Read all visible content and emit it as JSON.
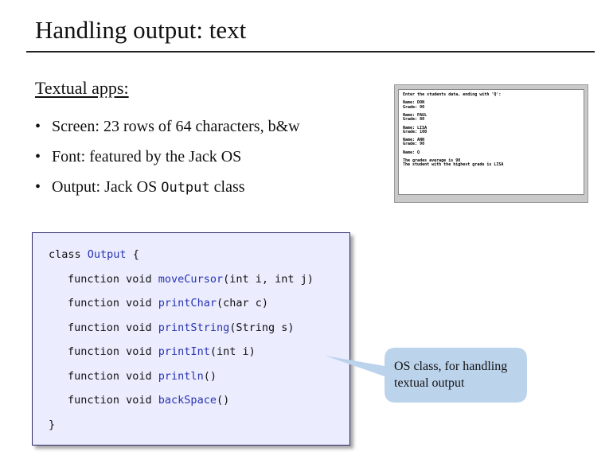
{
  "slide": {
    "title": "Handling output: text",
    "section_heading": "Textual apps:",
    "bullets": [
      {
        "text": "Screen: 23 rows of 64 characters, b&w"
      },
      {
        "text": "Font: featured by the Jack OS"
      },
      {
        "before": "Output: Jack OS ",
        "code": "Output",
        "after": " class"
      }
    ]
  },
  "screen_demo": {
    "lines": [
      "Enter the students data, ending with 'Q':",
      "",
      "Name: DON",
      "Grade: 90",
      "",
      "Name: PAUL",
      "Grade: 80",
      "",
      "Name: LISA",
      "Grade: 100",
      "",
      "Name: ANN",
      "Grade: 90",
      "",
      "Name: Q",
      "",
      "The grades average is 90",
      "The student with the highest grade is LISA"
    ]
  },
  "code": {
    "class_kw": "class ",
    "class_name": "Output",
    "open_brace": " {",
    "close_brace": "}",
    "functions": [
      {
        "prefix": "function void ",
        "name": "moveCursor",
        "params": "(int i, int j)"
      },
      {
        "prefix": "function void ",
        "name": "printChar",
        "params": "(char c)"
      },
      {
        "prefix": "function void ",
        "name": "printString",
        "params": "(String s)"
      },
      {
        "prefix": "function void ",
        "name": "printInt",
        "params": "(int i)"
      },
      {
        "prefix": "function void ",
        "name": "println",
        "params": "()"
      },
      {
        "prefix": "function void ",
        "name": "backSpace",
        "params": "()"
      }
    ]
  },
  "callout": {
    "line1": "OS class, for handling",
    "line2": "textual output"
  },
  "colors": {
    "code_identifier": "#2633b0",
    "code_background": "#ececff",
    "callout_fill": "#bcd3ec"
  }
}
